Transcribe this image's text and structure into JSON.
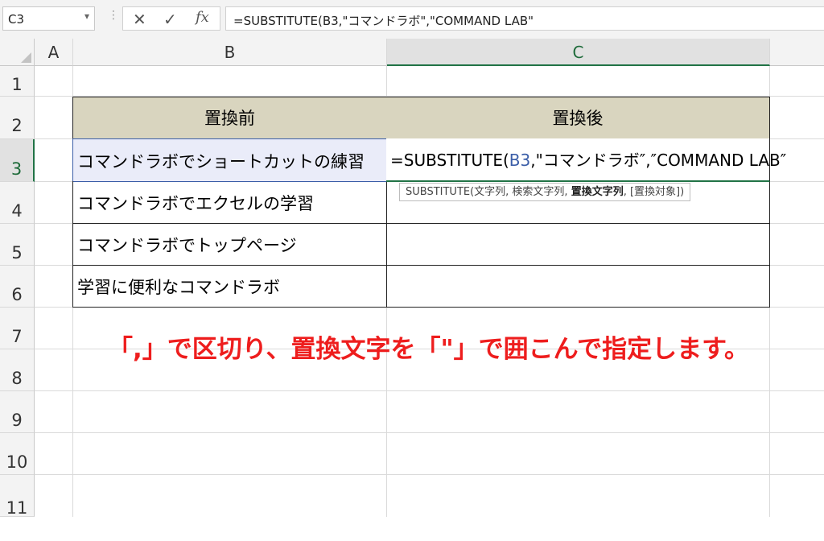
{
  "formula_bar": {
    "name_box": "C3",
    "cancel_icon": "✕",
    "enter_icon": "✓",
    "fx_label": "fx",
    "formula": "=SUBSTITUTE(B3,\"コマンドラボ\",\"COMMAND LAB\""
  },
  "columns": [
    "A",
    "B",
    "C"
  ],
  "rows": [
    "1",
    "2",
    "3",
    "4",
    "5",
    "6",
    "7",
    "8",
    "9",
    "10",
    "11"
  ],
  "table": {
    "headers": [
      "置換前",
      "置換後"
    ],
    "b_values": [
      "コマンドラボでショートカットの練習",
      "コマンドラボでエクセルの学習",
      "コマンドラボでトップページ",
      "学習に便利なコマンドラボ"
    ],
    "edit_cell": {
      "prefix": "=SUBSTITUTE(",
      "ref": "B3",
      "rest": ",\"コマンドラボ″,″COMMAND LAB″"
    }
  },
  "tooltip": {
    "pre": "SUBSTITUTE(文字列, 検索文字列, ",
    "bold": "置換文字列",
    "post": ", [置換対象])"
  },
  "annotation": "「,」で区切り、置換文字を「\"」で囲こんで指定します。",
  "colors": {
    "header_fill": "#d9d5bf",
    "selected_fill": "#eaecf9",
    "annotation": "#ee1d1d",
    "cell_ref": "#3b5ea8"
  }
}
